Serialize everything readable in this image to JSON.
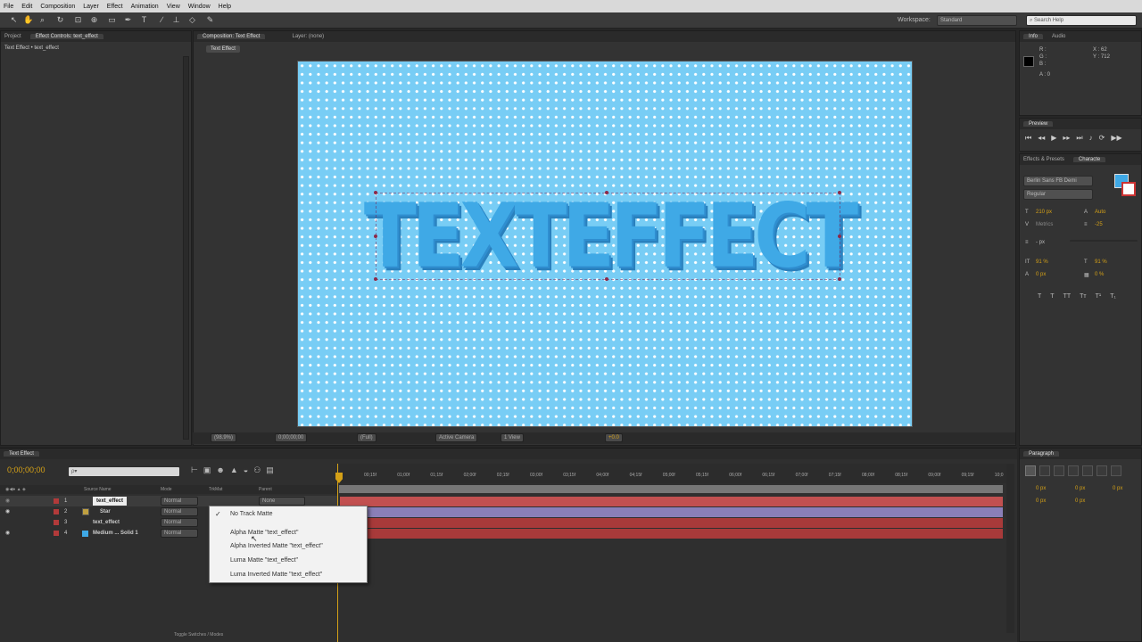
{
  "menu": [
    "File",
    "Edit",
    "Composition",
    "Layer",
    "Effect",
    "Animation",
    "View",
    "Window",
    "Help"
  ],
  "workspace": {
    "label": "Workspace:",
    "value": "Standard",
    "search_placeholder": "Search Help"
  },
  "project_panel": {
    "tab_project": "Project",
    "tab_effect_controls": "Effect Controls: text_effect",
    "subtitle": "Text Effect • text_effect"
  },
  "comp_panel": {
    "tab": "Composition: Text Effect",
    "tab_layer": "Layer: (none)",
    "comp_tab": "Text Effect",
    "canvas_text": "TEXTEFFECT",
    "footer": {
      "zoom": "(98.9%)",
      "timecode": "0;00;00;00",
      "res": "(Full)",
      "camera": "Active Camera",
      "views": "1 View",
      "exposure": "+0.0"
    }
  },
  "info_panel": {
    "tab_info": "Info",
    "tab_audio": "Audio",
    "r": "R :",
    "g": "G :",
    "b": "B :",
    "a": "A : 0",
    "x": "X : 62",
    "y": "Y : 712"
  },
  "preview_panel": {
    "tab": "Preview"
  },
  "character_panel": {
    "tab_effects": "Effects & Presets",
    "tab_character": "Characte",
    "font": "Berlin Sans FB Demi",
    "style": "Regular",
    "size": "210 px",
    "leading": "Auto",
    "kerning": "Metrics",
    "tracking": "-25",
    "stroke": "- px",
    "vscale": "91 %",
    "hscale": "91 %",
    "baseline": "0 px",
    "tsume": "0 %"
  },
  "paragraph_panel": {
    "tab": "Paragraph",
    "indent_left": "0 px",
    "indent_right": "0 px",
    "first": "0 px",
    "space_before": "0 px",
    "space_after": "0 px"
  },
  "timeline": {
    "tab": "Text Effect",
    "timecode": "0;00;00;00",
    "search_placeholder": "ρ▾",
    "columns": {
      "name": "Source Name",
      "mode": "Mode",
      "trkmat": "TrkMat",
      "parent": "Parent"
    },
    "toggle_label": "Toggle Switches / Modes",
    "layers": [
      {
        "num": "1",
        "name": "text_effect",
        "mode": "Normal"
      },
      {
        "num": "2",
        "name": "Star",
        "mode": "Normal"
      },
      {
        "num": "3",
        "name": "text_effect",
        "mode": "Normal"
      },
      {
        "num": "4",
        "name": "Medium ... Solid 1",
        "mode": "Normal"
      }
    ],
    "parent_value": "None",
    "ruler": [
      "00;15f",
      "01;00f",
      "01;15f",
      "02;00f",
      "02;15f",
      "03;00f",
      "03;15f",
      "04;00f",
      "04;15f",
      "05;00f",
      "05;15f",
      "06;00f",
      "06;15f",
      "07;00f",
      "07;15f",
      "08;00f",
      "08;15f",
      "09;00f",
      "09;15f",
      "10;0"
    ]
  },
  "trackmatte_menu": {
    "items": [
      "No Track Matte",
      "Alpha Matte \"text_effect\"",
      "Alpha Inverted Matte \"text_effect\"",
      "Luma Matte \"text_effect\"",
      "Luma Inverted Matte \"text_effect\""
    ],
    "checked": "✓"
  },
  "colors": {
    "accent": "#d4a017",
    "canvas": "#78cdf5",
    "text": "#3fa9e6",
    "track_red": "#b23a3a",
    "track_purple": "#8a7fb8"
  }
}
